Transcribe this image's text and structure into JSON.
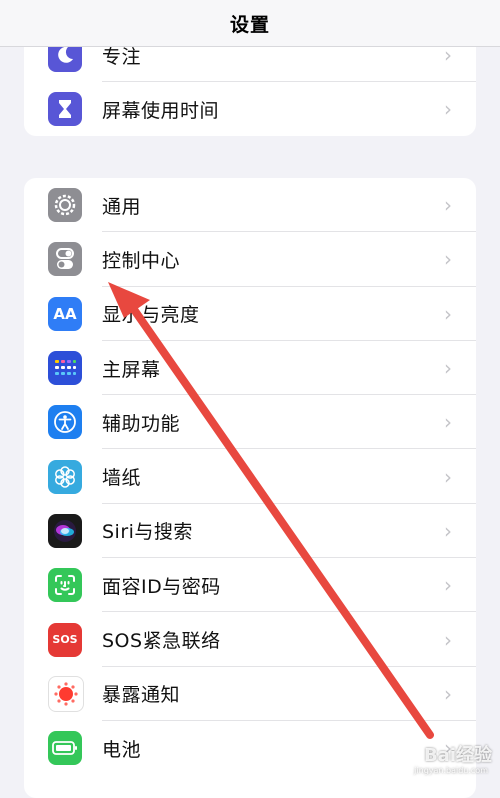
{
  "header": {
    "title": "设置"
  },
  "group1": [
    {
      "label": "专注",
      "icon": "moon-icon",
      "color": "#5856d6"
    },
    {
      "label": "屏幕使用时间",
      "icon": "hourglass-icon",
      "color": "#5856d6"
    }
  ],
  "group2": [
    {
      "label": "通用",
      "icon": "gear-icon",
      "color": "#8e8e93"
    },
    {
      "label": "控制中心",
      "icon": "toggle-icon",
      "color": "#8e8e93"
    },
    {
      "label": "显示与亮度",
      "icon": "text-size-icon",
      "color": "#2f7df6"
    },
    {
      "label": "主屏幕",
      "icon": "app-grid-icon",
      "color": "#2d4fd8"
    },
    {
      "label": "辅助功能",
      "icon": "accessibility-icon",
      "color": "#1e7ff0"
    },
    {
      "label": "墙纸",
      "icon": "flower-icon",
      "color": "#36aadf"
    },
    {
      "label": "Siri与搜索",
      "icon": "siri-icon",
      "color": "#1a1a1a"
    },
    {
      "label": "面容ID与密码",
      "icon": "face-id-icon",
      "color": "#34c759"
    },
    {
      "label": "SOS紧急联络",
      "icon": "sos-icon",
      "color": "#e53935",
      "icon_text": "SOS"
    },
    {
      "label": "暴露通知",
      "icon": "exposure-icon",
      "color": "#ffffff"
    },
    {
      "label": "电池",
      "icon": "battery-icon",
      "color": "#34c759"
    }
  ],
  "icons": {
    "text_size": "AA"
  },
  "annotation": {
    "arrow_color": "#e8483f"
  },
  "watermark": {
    "text": "Bai经验",
    "sub": "jingyan.baidu.com"
  }
}
